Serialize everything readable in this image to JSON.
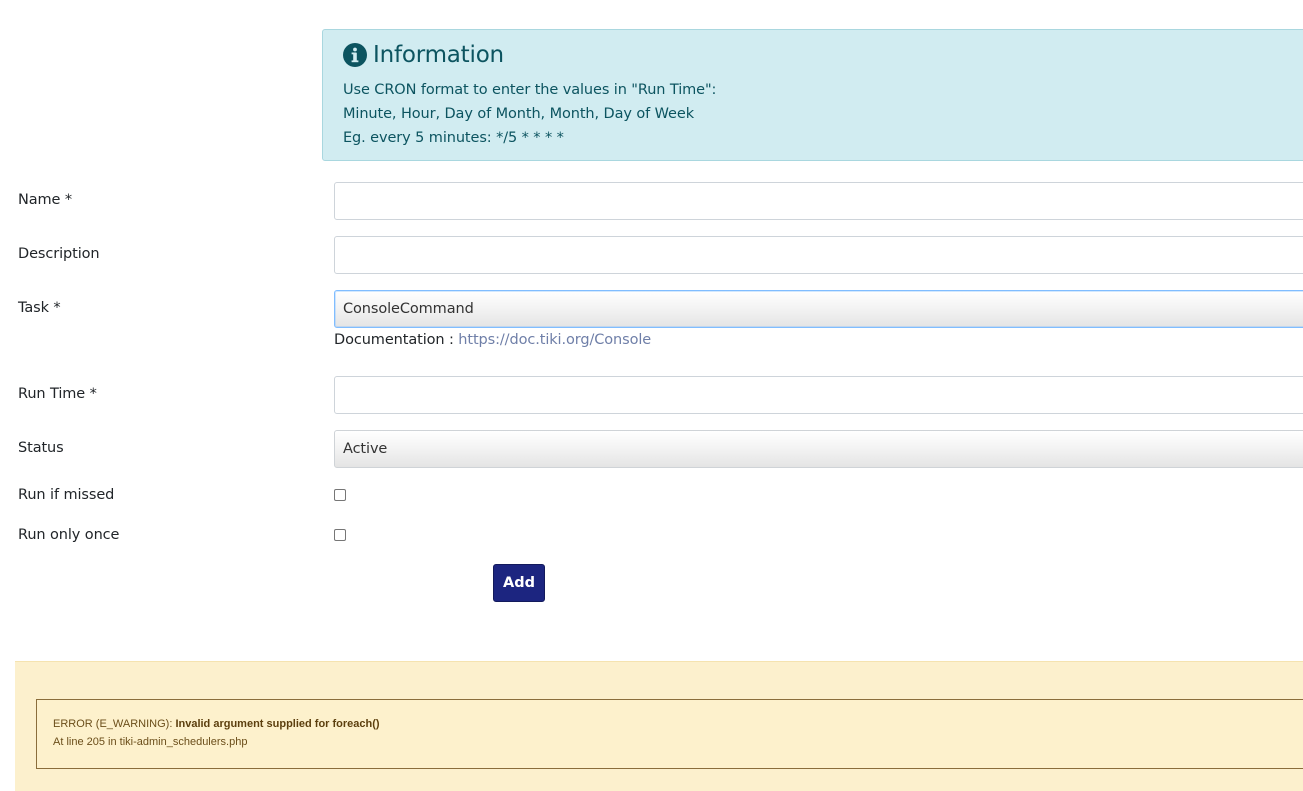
{
  "info": {
    "title": "Information",
    "line1": "Use CRON format to enter the values in \"Run Time\":",
    "line2": "Minute, Hour, Day of Month, Month, Day of Week",
    "line3": "Eg. every 5 minutes: */5 * * * *",
    "icon": "info-circle-icon",
    "bg_color": "#d1ecf1",
    "text_color": "#0c5460"
  },
  "form": {
    "name_label": "Name *",
    "name_value": "",
    "description_label": "Description",
    "description_value": "",
    "task_label": "Task *",
    "task_selected": "ConsoleCommand",
    "doc_prefix": "Documentation :",
    "doc_link": "https://doc.tiki.org/Console",
    "runtime_label": "Run Time *",
    "runtime_value": "",
    "status_label": "Status",
    "status_selected": "Active",
    "run_if_missed_label": "Run if missed",
    "run_if_missed_checked": false,
    "run_only_once_label": "Run only once",
    "run_only_once_checked": false,
    "add_label": "Add",
    "add_color": "#1c2580",
    "link_color": "#6f7fa8"
  },
  "error": {
    "prefix": "ERROR (E_WARNING):",
    "message": "Invalid argument supplied for foreach()",
    "location": "At line 205 in tiki-admin_schedulers.php",
    "bg_color": "#fcf0cd"
  }
}
